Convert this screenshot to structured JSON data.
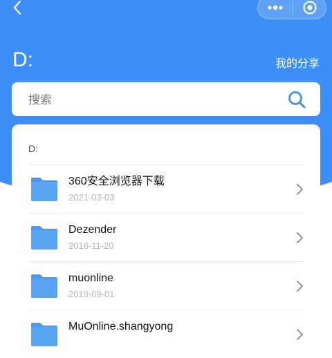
{
  "header": {
    "title": "D:",
    "share_label": "我的分享"
  },
  "search": {
    "placeholder": "搜索",
    "value": ""
  },
  "card": {
    "path": "D:"
  },
  "files": [
    {
      "name": "360安全浏览器下载",
      "date": "2021-03-03",
      "icon": "folder-icon"
    },
    {
      "name": "Dezender",
      "date": "2016-11-20",
      "icon": "folder-icon"
    },
    {
      "name": "muonline",
      "date": "2019-09-01",
      "icon": "folder-icon"
    },
    {
      "name": "MuOnline.shangyong",
      "date": "",
      "icon": "folder-icon"
    }
  ],
  "colors": {
    "accent": "#3e8ef7",
    "folder": "#4a98f1"
  }
}
